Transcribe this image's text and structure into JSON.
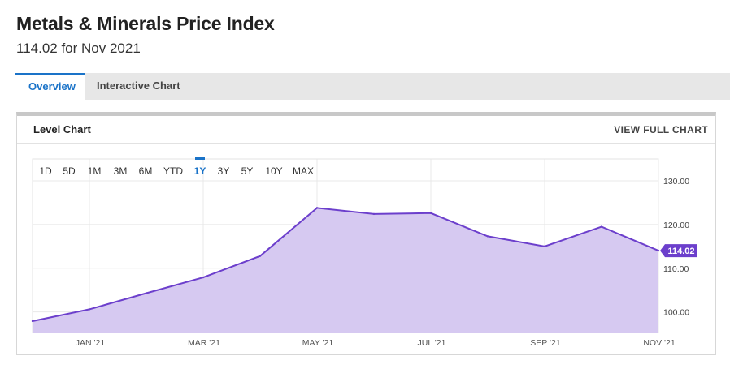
{
  "header": {
    "title": "Metals & Minerals Price Index",
    "subtitle": "114.02 for Nov 2021"
  },
  "tabs": [
    {
      "label": "Overview",
      "active": true
    },
    {
      "label": "Interactive Chart",
      "active": false
    }
  ],
  "card": {
    "title": "Level Chart",
    "full_chart_link": "VIEW FULL CHART"
  },
  "range_buttons": [
    "1D",
    "5D",
    "1M",
    "3M",
    "6M",
    "YTD",
    "1Y",
    "3Y",
    "5Y",
    "10Y",
    "MAX"
  ],
  "range_selected": "1Y",
  "colors": {
    "accent": "#1a73c8",
    "line": "#6c3fcc",
    "fill": "#d6c9f1",
    "label_bg": "#6c3fcc"
  },
  "chart_data": {
    "type": "area",
    "x": [
      "Dec 2020",
      "Jan 2021",
      "Feb 2021",
      "Mar 2021",
      "Apr 2021",
      "May 2021",
      "Jun 2021",
      "Jul 2021",
      "Aug 2021",
      "Sep 2021",
      "Oct 2021",
      "Nov 2021"
    ],
    "series": [
      {
        "values": [
          97.9,
          100.6,
          104.3,
          107.9,
          112.8,
          123.8,
          122.4,
          122.6,
          117.3,
          115.0,
          119.5,
          114.02
        ]
      }
    ],
    "x_tick_labels": [
      "JAN '21",
      "MAR '21",
      "MAY '21",
      "JUL '21",
      "SEP '21",
      "NOV '21"
    ],
    "y_tick_labels": [
      "100.00",
      "110.00",
      "120.00",
      "130.00"
    ],
    "y_ticks": [
      100,
      110,
      120,
      130
    ],
    "ylim": [
      95.3,
      135.0
    ],
    "last_value_label": "114.02",
    "grid": true
  }
}
